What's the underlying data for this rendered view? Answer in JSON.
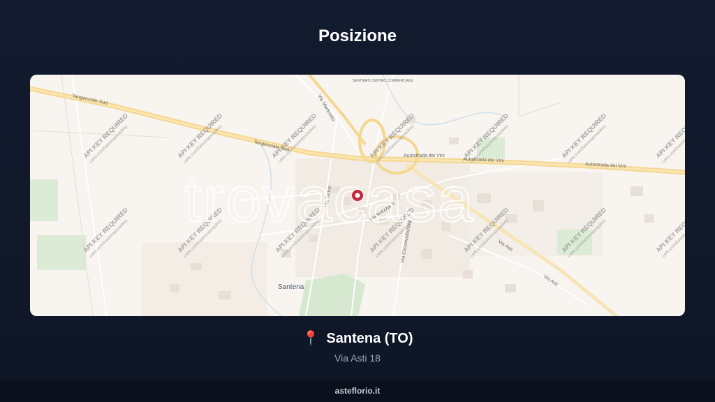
{
  "page": {
    "title": "Posizione"
  },
  "map": {
    "logo_text": "trovacasa",
    "watermark_main": "API KEY REQUIRED",
    "watermark_sub": "carto.com/basemaps/apikey",
    "labels": {
      "tangenziale_sud_1": "Tangenziale Sud",
      "tangenziale_sud_2": "Tangenziale Sud",
      "autostrada_1": "Autostrada dei Vini",
      "autostrada_2": "Autostrada dei Vini",
      "autostrada_3": "Autostrada dei Vini",
      "via_asti_1": "Via Asti",
      "via_asti_2": "Via Asti",
      "via_torino": "Via Torino",
      "via_martinetto": "Via Martinetto",
      "via_circonvallazione": "Via Circonvallazione",
      "via_avezzano": "Via Avezzano",
      "sentiero": "SENTIERO CENTRO COMMERCIALE",
      "town": "Santena"
    },
    "pin_color": "#c0293b"
  },
  "location": {
    "pin_icon": "📍",
    "city": "Santena (TO)",
    "address": "Via Asti 18"
  },
  "footer": {
    "brand": "asteflorio.it"
  }
}
